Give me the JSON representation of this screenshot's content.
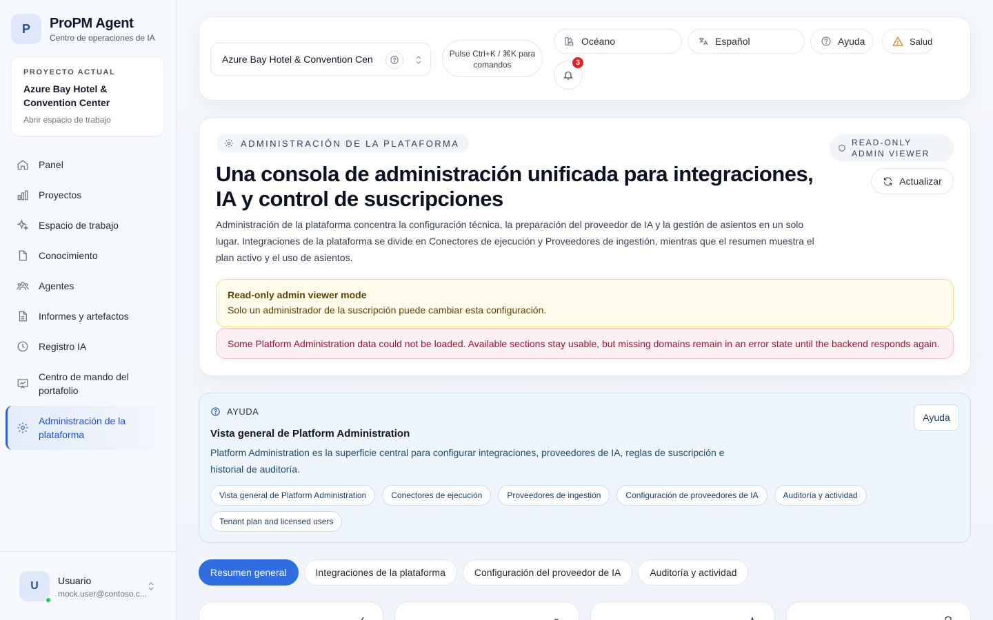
{
  "brand": {
    "initial": "P",
    "title": "ProPM Agent",
    "subtitle": "Centro de operaciones de IA"
  },
  "project_card": {
    "kicker": "PROYECTO ACTUAL",
    "name": "Azure Bay Hotel & Convention Center",
    "link": "Abrir espacio de trabajo"
  },
  "nav": [
    {
      "label": "Panel",
      "icon": "home-icon"
    },
    {
      "label": "Proyectos",
      "icon": "bar-chart-icon"
    },
    {
      "label": "Espacio de trabajo",
      "icon": "sparkles-icon"
    },
    {
      "label": "Conocimiento",
      "icon": "file-icon"
    },
    {
      "label": "Agentes",
      "icon": "users-icon"
    },
    {
      "label": "Informes y artefactos",
      "icon": "file-text-icon"
    },
    {
      "label": "Registro IA",
      "icon": "clock-icon"
    },
    {
      "label": "Centro de mando del portafolio",
      "icon": "presentation-chart-icon"
    },
    {
      "label": "Administración de la plataforma",
      "icon": "gear-icon",
      "active": true
    }
  ],
  "user": {
    "initial": "U",
    "name": "Usuario",
    "email": "mock.user@contoso.c...",
    "status_color": "#22c55e"
  },
  "topbar": {
    "project_select": "Azure Bay Hotel & Convention Cen",
    "command_hint": "Pulse Ctrl+K / ⌘K para comandos",
    "theme": "Océano",
    "language": "Español",
    "help": "Ayuda",
    "health": "Salud",
    "notifications_count": "3"
  },
  "hero": {
    "kicker": "ADMINISTRACIÓN DE LA PLATAFORMA",
    "readonly_badge": "READ-ONLY ADMIN VIEWER",
    "refresh": "Actualizar",
    "title": "Una consola de administración unificada para integraciones, IA y control de suscripciones",
    "description": "Administración de la plataforma concentra la configuración técnica, la preparación del proveedor de IA y la gestión de asientos en un solo lugar. Integraciones de la plataforma se divide en Conectores de ejecución y Proveedores de ingestión, mientras que el resumen muestra el plan activo y el uso de asientos.",
    "warning_title": "Read-only admin viewer mode",
    "warning_text": "Solo un administrador de la suscripción puede cambiar esta configuración.",
    "error_text": "Some Platform Administration data could not be loaded. Available sections stay usable, but missing domains remain in an error state until the backend responds again."
  },
  "help": {
    "kicker": "AYUDA",
    "button": "Ayuda",
    "title": "Vista general de Platform Administration",
    "description": "Platform Administration es la superficie central para configurar integraciones, proveedores de IA, reglas de suscripción e historial de auditoría.",
    "chips": [
      "Vista general de Platform Administration",
      "Conectores de ejecución",
      "Proveedores de ingestión",
      "Configuración de proveedores de IA",
      "Auditoría y actividad",
      "Tenant plan and licensed users"
    ]
  },
  "tabs": [
    {
      "label": "Resumen general",
      "active": true
    },
    {
      "label": "Integraciones de la plataforma"
    },
    {
      "label": "Configuración del proveedor de IA"
    },
    {
      "label": "Auditoría y actividad"
    }
  ],
  "colors": {
    "accent": "#2f6de0",
    "warning_bg": "#fefbea",
    "error_bg": "#fdf0f2",
    "help_bg": "#eef5fc"
  }
}
